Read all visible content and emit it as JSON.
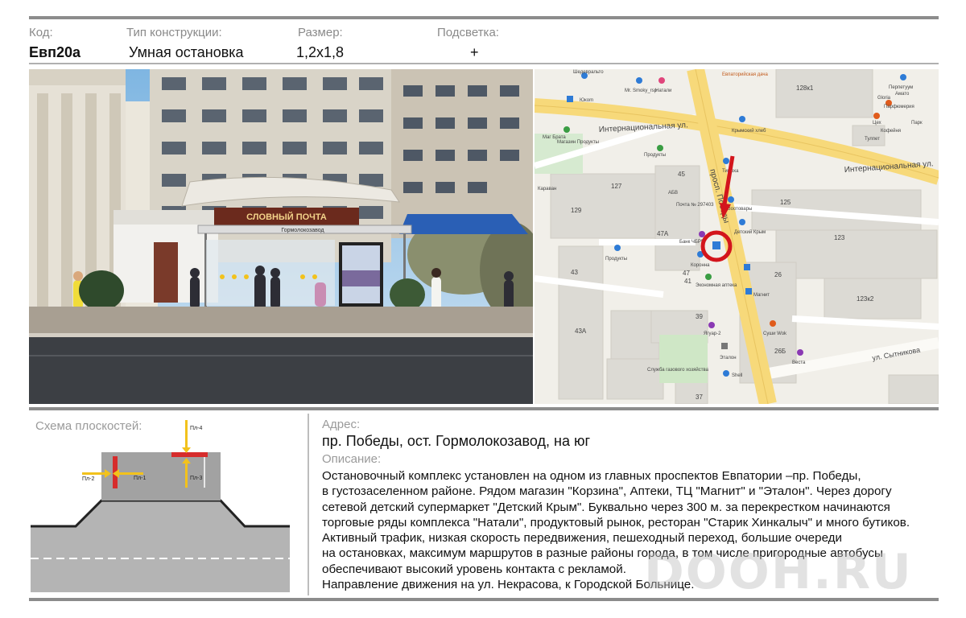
{
  "header": {
    "code_label": "Код:",
    "code_value": "Евп20а",
    "type_label": "Тип конструкции:",
    "type_value": "Умная остановка",
    "size_label": "Размер:",
    "size_value": "1,2х1,8",
    "light_label": "Подсветка:",
    "light_value": "+"
  },
  "photo": {
    "stop_name": "Гормолокозавод"
  },
  "map": {
    "streets": {
      "internatsionalnaya_1": "Интернациональная ул.",
      "internatsionalnaya_2": "Интернациональная ул.",
      "pobedy": "просп. Победы",
      "sytnikova": "ул. Сытникова"
    },
    "buildings": [
      "128к1",
      "127",
      "129",
      "45",
      "47А",
      "47",
      "43",
      "43А",
      "41",
      "39",
      "37",
      "125",
      "123",
      "123к2",
      "26",
      "26Б"
    ],
    "pois": [
      "Шедевральто",
      "Mr. Smoky_rsp",
      "Натали",
      "Юкоm",
      "Евпаторийская дача",
      "Крымский хлеб",
      "Продукты",
      "Магазин Продукты",
      "Маг Брата",
      "Тимоха",
      "Почта № 297403",
      "Зоотовары",
      "Детский Крым",
      "Банк ЧБРР",
      "Коронна",
      "Продукты",
      "Экономная аптека",
      "Магнит",
      "Ягуар-2",
      "Эталон",
      "Shell",
      "Служба газового хозяйства",
      "Суши Wok",
      "Веста",
      "Тулпет",
      "Перпетуум",
      "Gloria",
      "Амато",
      "Парфюмерия",
      "Цех",
      "Парк",
      "Кофейня",
      "Караван",
      "АБВ"
    ],
    "colors": {
      "main_road": "#f7d97a",
      "water_marker": "#2e7bd6",
      "target": "#d3151c",
      "pointer": "#d3151c"
    }
  },
  "schema": {
    "title": "Схема плоскостей:",
    "planes": [
      "Пл-1",
      "Пл-2",
      "Пл-3",
      "Пл-4"
    ],
    "colors": {
      "road": "#b4b4b4",
      "plane": "#d62c2c",
      "arrow": "#f2c21c"
    }
  },
  "address": {
    "label": "Адрес:",
    "value": "пр. Победы, ост. Гормолокозавод, на юг"
  },
  "description": {
    "label": "Описание:",
    "lines": [
      "Остановочный комплекс установлен на одном из главных проспектов Евпатории –пр. Победы,",
      "в густозаселенном районе. Рядом магазин \"Корзина\", Аптеки, ТЦ \"Магнит\" и \"Эталон\". Через дорогу",
      "сетевой детский супермаркет \"Детский Крым\". Буквально через 300 м. за перекрестком начинаются",
      "торговые ряды комплекса \"Натали\", продуктовый рынок, ресторан \"Старик Хинкалыч\" и много бутиков.",
      "Активный трафик, низкая скорость передвижения, пешеходный переход, большие очереди",
      "на остановках, максимум маршрутов в разные районы города, в том числе пригородные автобусы",
      "обеспечивают высокий уровень контакта с рекламой.",
      "Направление движения на ул. Некрасова, к Городской Больнице."
    ]
  },
  "watermark": "DOOH.RU"
}
